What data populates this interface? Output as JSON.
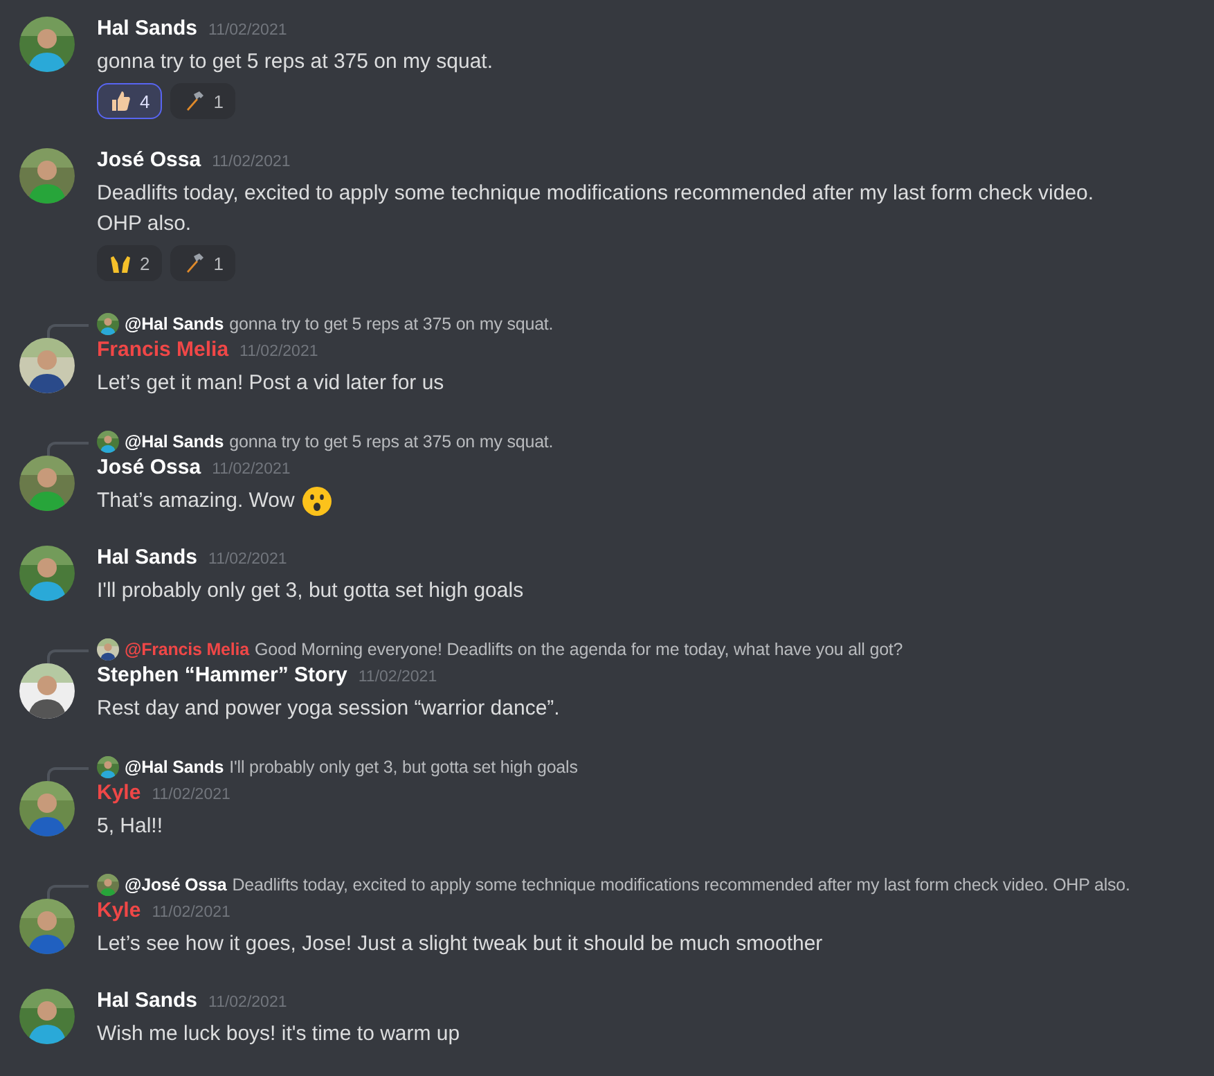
{
  "messages": [
    {
      "author": "Hal Sands",
      "color": "#ffffff",
      "timestamp": "11/02/2021",
      "lines": [
        "gonna try to get 5 reps at 375 on my squat."
      ],
      "reactions": [
        {
          "kind": "thumbs",
          "count": "4",
          "selected": true
        },
        {
          "kind": "hammer",
          "count": "1",
          "selected": false
        }
      ]
    },
    {
      "author": "José Ossa",
      "color": "#ffffff",
      "timestamp": "11/02/2021",
      "lines": [
        "Deadlifts today, excited to apply some technique modifications recommended after my last form check video.",
        "OHP also."
      ],
      "reactions": [
        {
          "kind": "hands",
          "count": "2",
          "selected": false
        },
        {
          "kind": "hammer",
          "count": "1",
          "selected": false
        }
      ]
    },
    {
      "reply": {
        "author": "@Hal Sands",
        "color": "#ffffff",
        "text": "gonna try to get 5 reps at 375 on my squat."
      },
      "author": "Francis Melia",
      "color": "#f04747",
      "timestamp": "11/02/2021",
      "lines": [
        "Let’s get it man! Post a vid later for us"
      ]
    },
    {
      "reply": {
        "author": "@Hal Sands",
        "color": "#ffffff",
        "text": "gonna try to get 5 reps at 375 on my squat."
      },
      "author": "José Ossa",
      "color": "#ffffff",
      "timestamp": "11/02/2021",
      "lines": [
        "That’s amazing. Wow"
      ],
      "emoji": true
    },
    {
      "author": "Hal Sands",
      "color": "#ffffff",
      "timestamp": "11/02/2021",
      "lines": [
        "I'll probably only get 3, but gotta set high goals"
      ]
    },
    {
      "reply": {
        "author": "@Francis Melia",
        "color": "#f04747",
        "text": "Good Morning everyone!   Deadlifts on the agenda for me today, what have you all got?"
      },
      "author": "Stephen “Hammer” Story",
      "color": "#ffffff",
      "timestamp": "11/02/2021",
      "lines": [
        "Rest day and power yoga session “warrior dance”."
      ]
    },
    {
      "reply": {
        "author": "@Hal Sands",
        "color": "#ffffff",
        "text": "I'll probably only get 3, but gotta set high goals"
      },
      "author": "Kyle",
      "color": "#f04747",
      "timestamp": "11/02/2021",
      "lines": [
        "5, Hal!!"
      ]
    },
    {
      "reply": {
        "author": "@José Ossa",
        "color": "#ffffff",
        "text": "Deadlifts today, excited to apply some technique modifications recommended after my last form check video.  OHP also."
      },
      "author": "Kyle",
      "color": "#f04747",
      "timestamp": "11/02/2021",
      "lines": [
        "Let’s see how it goes, Jose! Just a slight tweak but it should be much smoother"
      ]
    },
    {
      "author": "Hal Sands",
      "color": "#ffffff",
      "timestamp": "11/02/2021",
      "lines": [
        "Wish me luck boys! it's time to warm up"
      ]
    }
  ]
}
